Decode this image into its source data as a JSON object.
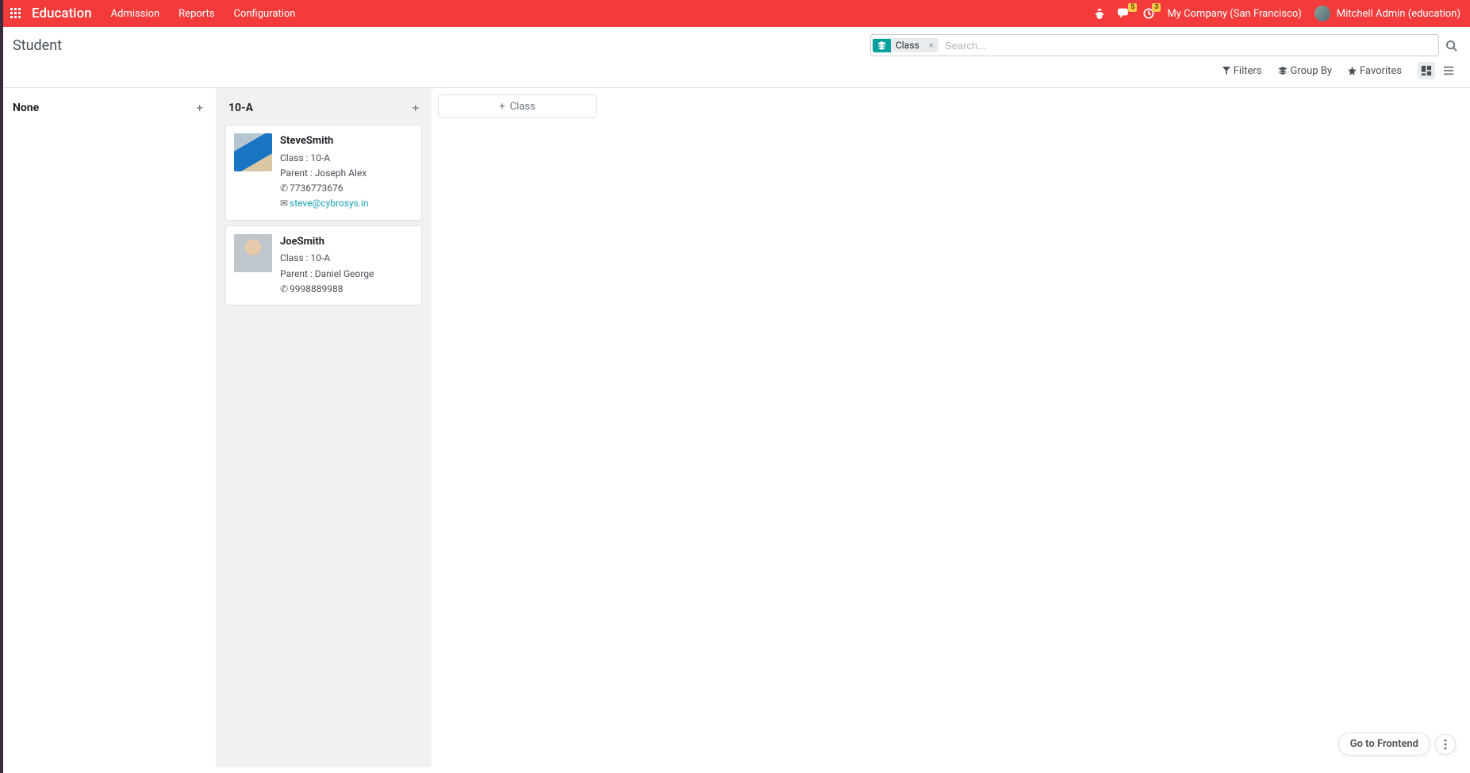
{
  "navbar": {
    "brand": "Education",
    "menu": [
      "Admission",
      "Reports",
      "Configuration"
    ],
    "msg_badge": "5",
    "activity_badge": "3",
    "company": "My Company (San Francisco)",
    "user": "Mitchell Admin (education)"
  },
  "page": {
    "title": "Student"
  },
  "search": {
    "facet_label": "Class",
    "placeholder": "Search..."
  },
  "toolbar": {
    "filters": "Filters",
    "groupby": "Group By",
    "favorites": "Favorites"
  },
  "columns": [
    {
      "title": "None",
      "cards": []
    },
    {
      "title": "10-A",
      "cards": [
        {
          "name": "SteveSmith",
          "class_label": "Class :",
          "class_value": "10-A",
          "parent_label": "Parent :",
          "parent_value": "Joseph Alex",
          "phone": "7736773676",
          "email": "steve@cybrosys.in"
        },
        {
          "name": "JoeSmith",
          "class_label": "Class :",
          "class_value": "10-A",
          "parent_label": "Parent :",
          "parent_value": "Daniel George",
          "phone": "9998889988",
          "email": ""
        }
      ]
    }
  ],
  "add_column_label": "Class",
  "frontend_btn": "Go to Frontend"
}
